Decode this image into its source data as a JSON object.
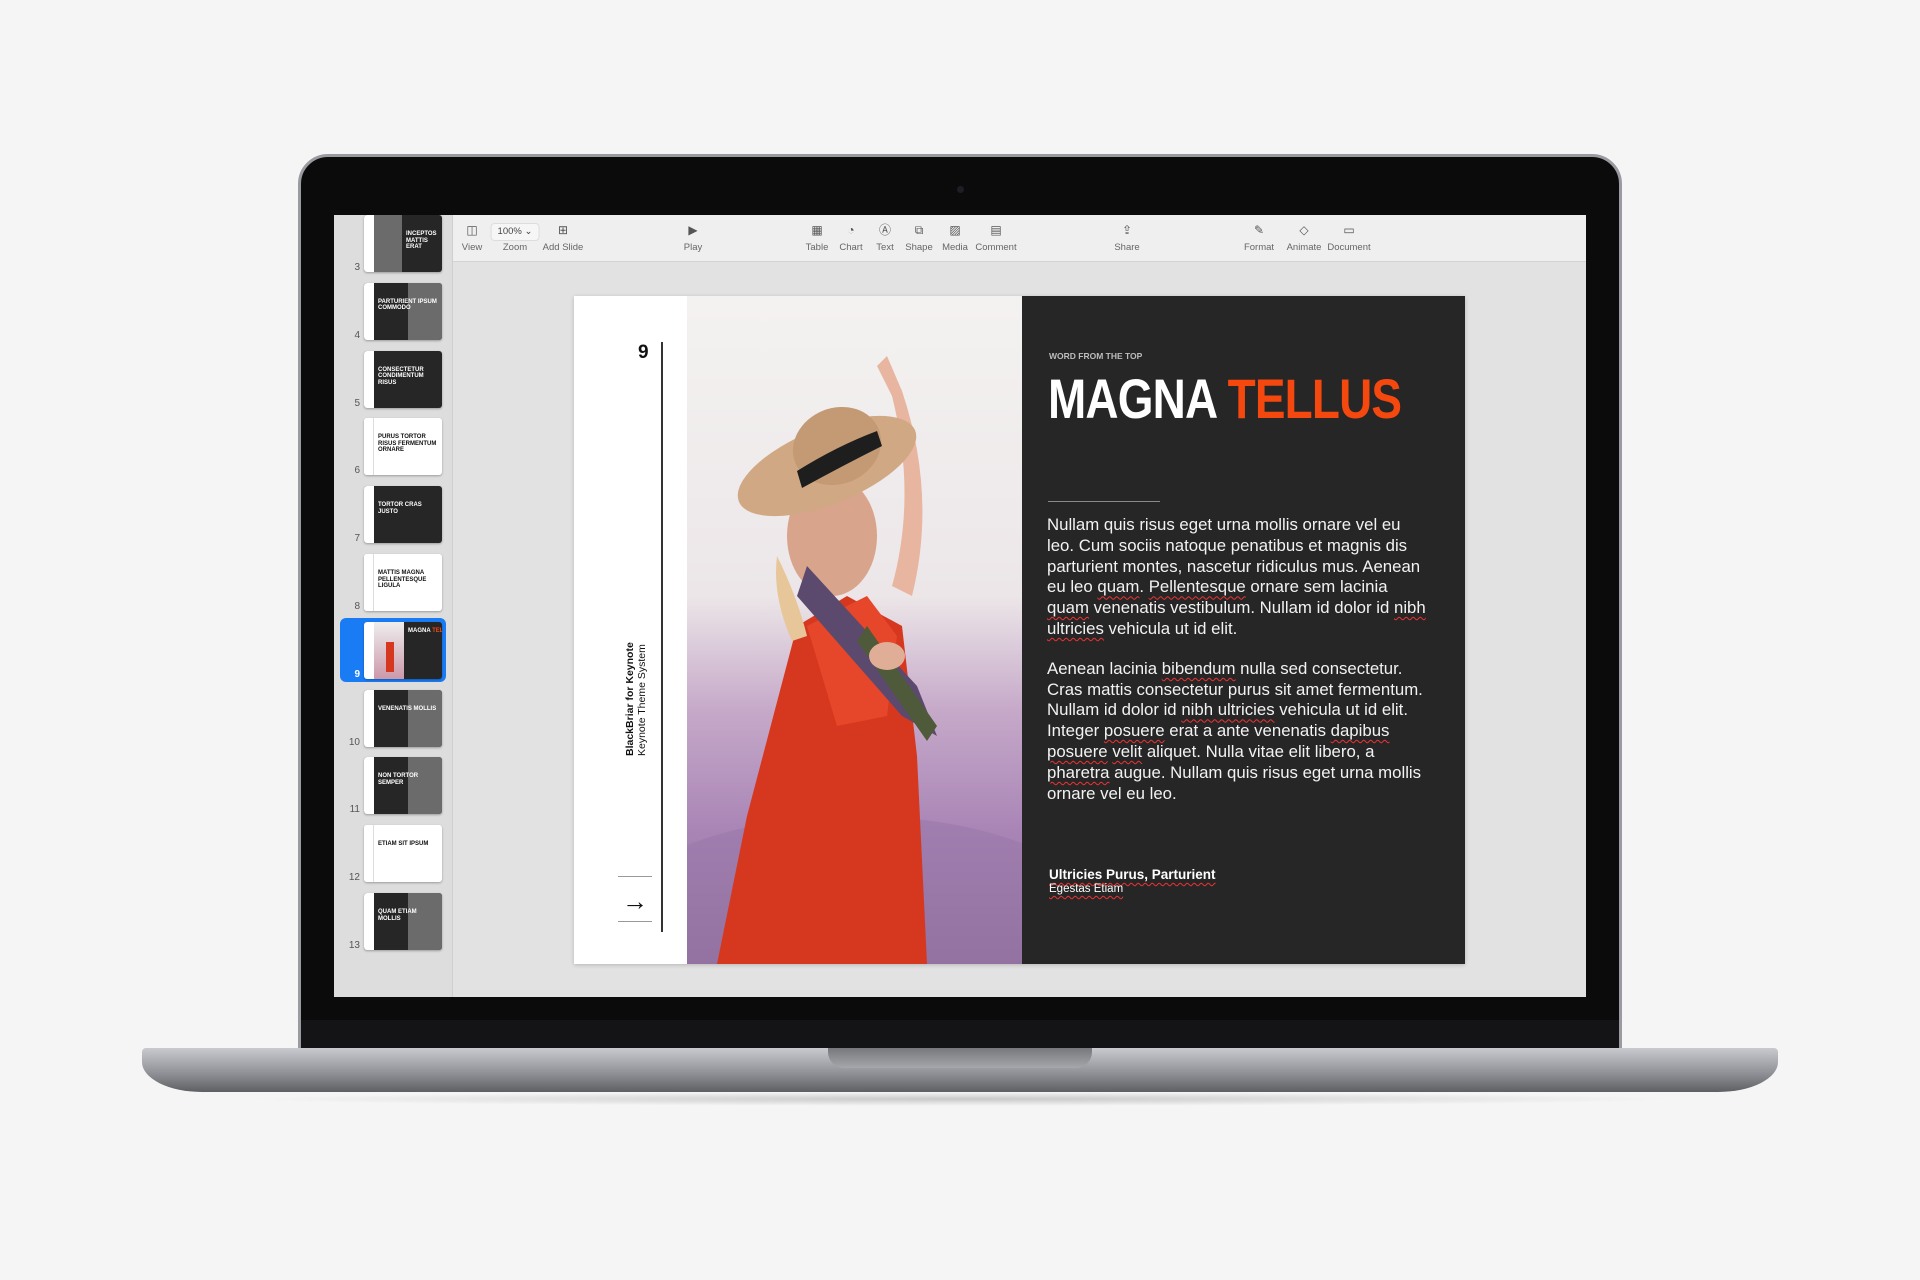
{
  "toolbar": {
    "view": "View",
    "zoom_value": "100%",
    "zoom": "Zoom",
    "add_slide": "Add Slide",
    "play": "Play",
    "table": "Table",
    "chart": "Chart",
    "text": "Text",
    "shape": "Shape",
    "media": "Media",
    "comment": "Comment",
    "share": "Share",
    "format": "Format",
    "animate": "Animate",
    "document": "Document"
  },
  "sidebar": {
    "selected": 9,
    "accent": "#1a7cf5",
    "slides": [
      {
        "num": "3",
        "title": "INCEPTOS MATTIS ERAT"
      },
      {
        "num": "4",
        "title": "PARTURIENT IPSUM COMMODO"
      },
      {
        "num": "5",
        "title": "CONSECTETUR CONDIMENTUM RISUS"
      },
      {
        "num": "6",
        "title": "PURUS TORTOR RISUS FERMENTUM ORNARE"
      },
      {
        "num": "7",
        "title": "TORTOR CRAS JUSTO"
      },
      {
        "num": "8",
        "title": "MATTIS MAGNA PELLENTESQUE LIGULA"
      },
      {
        "num": "9",
        "title": "MAGNA TELLUS"
      },
      {
        "num": "10",
        "title": "VENENATIS MOLLIS"
      },
      {
        "num": "11",
        "title": "NON TORTOR SEMPER"
      },
      {
        "num": "12",
        "title": "ETIAM SIT IPSUM"
      },
      {
        "num": "13",
        "title": "QUAM ETIAM MOLLIS"
      }
    ]
  },
  "slide": {
    "number": "9",
    "vertical_line1": "BlackBriar for Keynote",
    "vertical_line2": "Keynote Theme System",
    "kicker": "WORD FROM THE TOP",
    "title_a": "MAGNA",
    "title_b": "TELLUS",
    "accent": "#f4480f",
    "p1_a": "Nullam quis risus eget urna mollis ornare vel eu leo. Cum sociis natoque penatibus et magnis dis parturient montes, nascetur ridiculus mus. Aenean eu leo ",
    "p1_b": "quam",
    "p1_c": ". ",
    "p1_d": "Pellentesque",
    "p1_e": " ornare sem lacinia ",
    "p1_f": "quam",
    "p1_g": " venenatis vestibulum. Nullam id dolor id ",
    "p1_h": "nibh",
    "p1_i": " ",
    "p1_j": "ultricies",
    "p1_k": " vehicula ut id elit.",
    "p2_a": "Aenean lacinia ",
    "p2_b": "bibendum",
    "p2_c": " nulla sed consectetur. Cras mattis consectetur purus sit amet fermentum. Nullam id dolor id ",
    "p2_d": "nibh ultricies",
    "p2_e": " vehicula ut id elit. Integer ",
    "p2_f": "posuere",
    "p2_g": " erat a ante venenatis ",
    "p2_h": "dapibus posuere",
    "p2_i": " ",
    "p2_j": "velit",
    "p2_k": " aliquet. Nulla vitae elit libero, a ",
    "p2_l": "pharetra",
    "p2_m": " augue. Nullam quis risus eget urna mollis ornare vel eu leo.",
    "footer_name": "Ultricies Purus, Parturient",
    "footer_sub": "Egestas Etiam"
  }
}
